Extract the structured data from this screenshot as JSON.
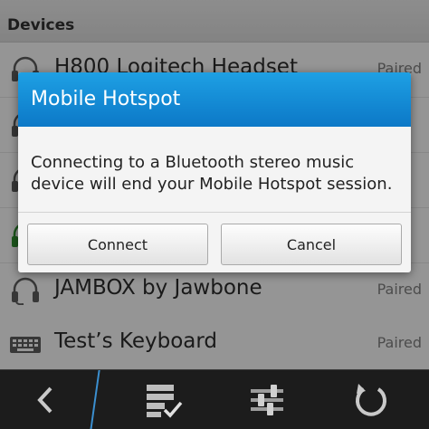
{
  "section_title": "Devices",
  "devices": [
    {
      "name": "H800 Logitech Headset",
      "status": "Paired",
      "icon": "headset-icon"
    },
    {
      "name": "",
      "status": "",
      "icon": "headset-icon"
    },
    {
      "name": "",
      "status": "",
      "icon": "headset-icon"
    },
    {
      "name": "",
      "status": "",
      "icon": "headset-icon"
    },
    {
      "name": "JAMBOX by Jawbone",
      "status": "Paired",
      "icon": "headset-icon"
    },
    {
      "name": "Test’s Keyboard",
      "status": "Paired",
      "icon": "keyboard-icon"
    }
  ],
  "dialog": {
    "title": "Mobile Hotspot",
    "message": "Connecting to a Bluetooth stereo music device will end your Mobile Hotspot session.",
    "connect_label": "Connect",
    "cancel_label": "Cancel"
  },
  "actionbar": {
    "icons": [
      "back-icon",
      "checklist-icon",
      "settings-sliders-icon",
      "refresh-icon"
    ]
  },
  "colors": {
    "dialog_header": "#1a93dd",
    "actionbar": "#1c1c1c",
    "accent": "#3b8fd0"
  }
}
